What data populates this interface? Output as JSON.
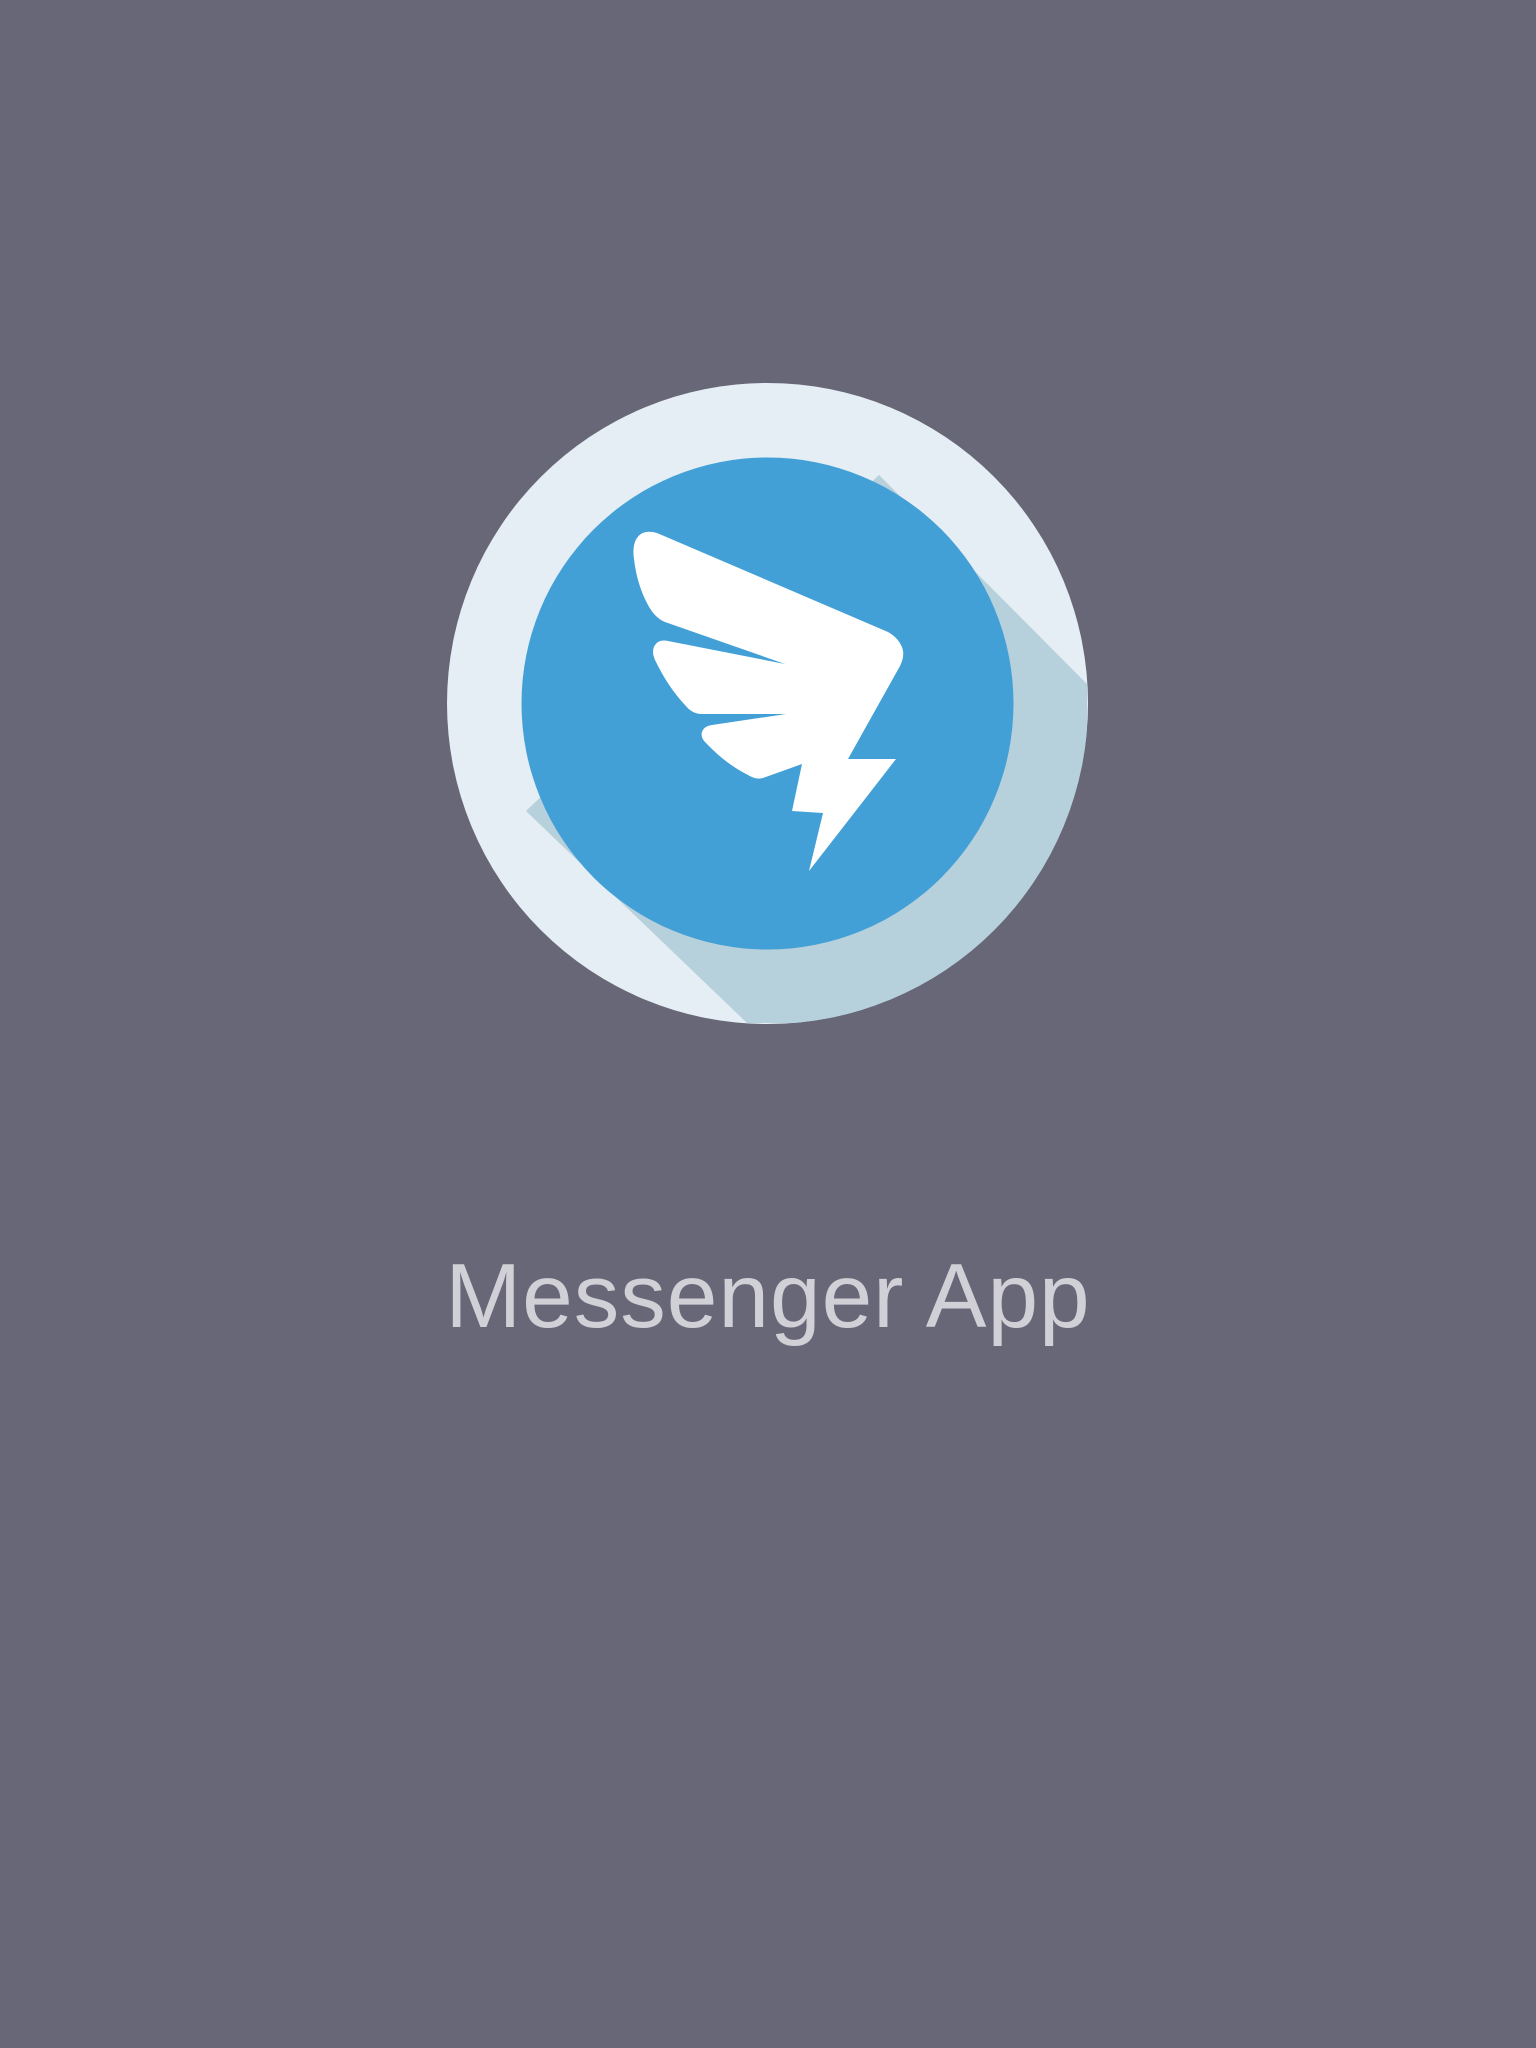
{
  "splash": {
    "app_name": "Messenger App",
    "logo_icon": "winged-lightning-logo-icon"
  },
  "colors": {
    "background": "#686777",
    "outer_ring": "#e5eef4",
    "shadow": "#b6d0dc",
    "inner_circle": "#42a0d7",
    "glyph": "#ffffff",
    "text": "#d0d0d6"
  }
}
